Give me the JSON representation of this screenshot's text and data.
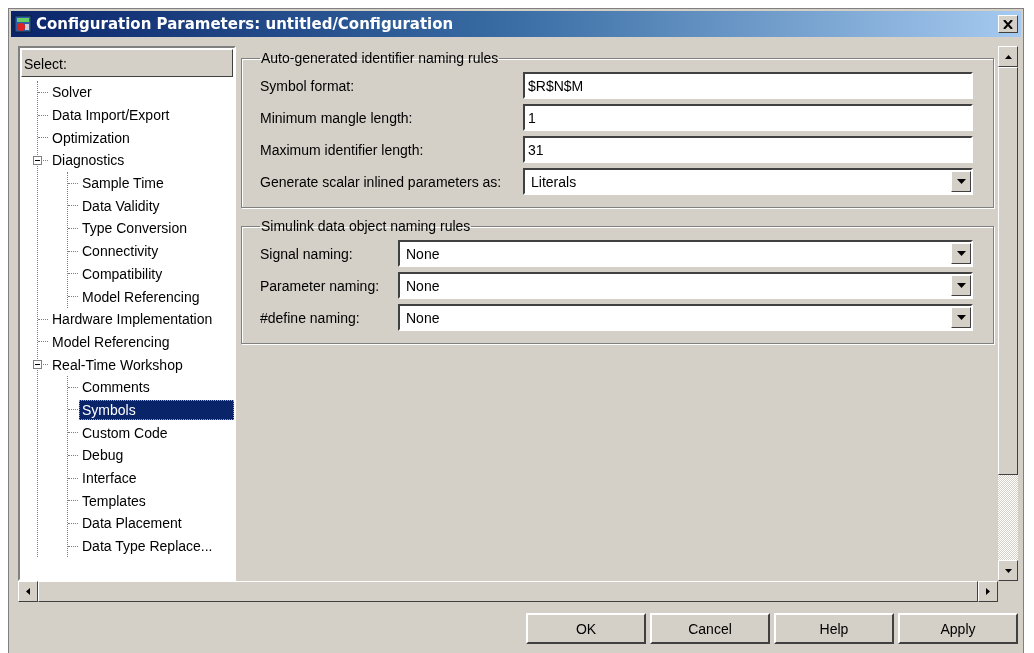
{
  "window": {
    "title": "Configuration Parameters: untitled/Configuration"
  },
  "tree": {
    "header": "Select:",
    "items": [
      {
        "label": "Solver",
        "selected": false
      },
      {
        "label": "Data Import/Export",
        "selected": false
      },
      {
        "label": "Optimization",
        "selected": false
      },
      {
        "label": "Diagnostics",
        "selected": false,
        "expanded": true,
        "children": [
          {
            "label": "Sample Time",
            "selected": false
          },
          {
            "label": "Data Validity",
            "selected": false
          },
          {
            "label": "Type Conversion",
            "selected": false
          },
          {
            "label": "Connectivity",
            "selected": false
          },
          {
            "label": "Compatibility",
            "selected": false
          },
          {
            "label": "Model Referencing",
            "selected": false
          }
        ]
      },
      {
        "label": "Hardware Implementation",
        "selected": false
      },
      {
        "label": "Model Referencing",
        "selected": false
      },
      {
        "label": "Real-Time Workshop",
        "selected": false,
        "expanded": true,
        "children": [
          {
            "label": "Comments",
            "selected": false
          },
          {
            "label": "Symbols",
            "selected": true
          },
          {
            "label": "Custom Code",
            "selected": false
          },
          {
            "label": "Debug",
            "selected": false
          },
          {
            "label": "Interface",
            "selected": false
          },
          {
            "label": "Templates",
            "selected": false
          },
          {
            "label": "Data Placement",
            "selected": false
          },
          {
            "label": "Data Type Replace...",
            "selected": false
          }
        ]
      }
    ]
  },
  "groups": [
    {
      "title": "Auto-generated identifier naming rules",
      "fields": [
        {
          "label": "Symbol format:",
          "kind": "text",
          "value": "$R$N$M"
        },
        {
          "label": "Minimum mangle length:",
          "kind": "text",
          "value": "1"
        },
        {
          "label": "Maximum identifier length:",
          "kind": "text",
          "value": "31"
        },
        {
          "label": "Generate scalar inlined parameters as:",
          "kind": "dropdown",
          "value": "Literals"
        }
      ]
    },
    {
      "title": "Simulink data object naming rules",
      "fields": [
        {
          "label": "Signal naming:",
          "kind": "dropdown",
          "value": "None"
        },
        {
          "label": "Parameter naming:",
          "kind": "dropdown",
          "value": "None"
        },
        {
          "label": "#define naming:",
          "kind": "dropdown",
          "value": "None"
        }
      ]
    }
  ],
  "buttons": [
    "OK",
    "Cancel",
    "Help",
    "Apply"
  ]
}
